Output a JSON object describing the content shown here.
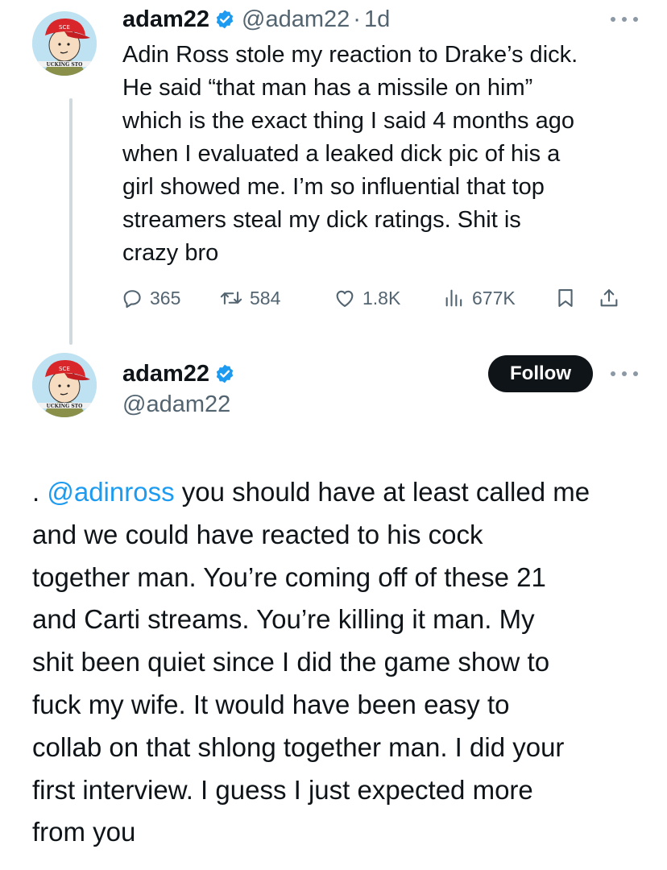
{
  "colors": {
    "text": "#0f1419",
    "secondary": "#536471",
    "link": "#1d9bf0",
    "verified_badge": "#1d9bf0",
    "follow_button_bg": "#0f1419",
    "thread_line": "#cfd9de"
  },
  "tweet1": {
    "author_name": "adam22",
    "handle": "@adam22",
    "separator": "·",
    "time": "1d",
    "avatar_caption": "UCKING STO",
    "text_lines": [
      "Adin Ross stole my reaction to Drake’s dick.",
      "He said “that man has a missile on him”",
      "which is the exact thing I said 4 months ago",
      "when I evaluated a leaked dick pic of his a",
      "girl showed me. I’m so influential that top",
      "streamers steal my dick ratings. Shit is",
      "crazy bro"
    ],
    "actions": {
      "replies": "365",
      "reposts": "584",
      "likes": "1.8K",
      "views": "677K"
    },
    "icons": [
      "reply-icon",
      "repost-icon",
      "like-icon",
      "views-icon",
      "bookmark-icon",
      "share-icon",
      "more-icon",
      "verified-icon"
    ]
  },
  "tweet2": {
    "author_name": "adam22",
    "handle": "@adam22",
    "follow_label": "Follow",
    "avatar_caption": "UCKING STO",
    "text_prefix": ". ",
    "mention": "@adinross",
    "first_line_rest": " you should have at least called me",
    "text_lines": [
      "and we could have reacted to his cock",
      "together man. You’re coming off of these 21",
      "and Carti streams. You’re killing it man. My",
      "shit been quiet since I did the game show to",
      "fuck my wife. It would have been easy to",
      "collab on that shlong together man. I did your",
      "first interview. I guess I just expected more",
      "from you"
    ]
  }
}
